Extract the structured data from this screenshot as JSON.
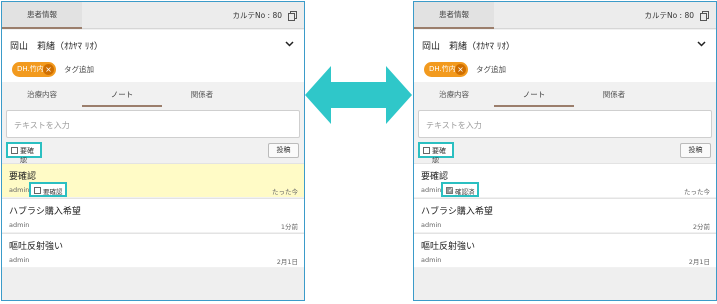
{
  "panels": [
    {
      "header": {
        "tab_label": "患者情報",
        "chart_no": "カルテNo : 80"
      },
      "patient": {
        "name": "岡山　莉緒（ｵｶﾔﾏ ﾘｵ）"
      },
      "tag": {
        "label": "DH.竹内",
        "add_label": "タグ追加"
      },
      "tabs": [
        {
          "label": "治療内容"
        },
        {
          "label": "ノート",
          "active": true
        },
        {
          "label": "関係者"
        }
      ],
      "input": {
        "placeholder": "テキストを入力"
      },
      "toolbar": {
        "filter_label": "要確認",
        "post_label": "投稿"
      },
      "notes": [
        {
          "title": "要確認",
          "author": "admin",
          "time": "たった今",
          "check_label": "要確認",
          "checked": false,
          "highlight": true
        },
        {
          "title": "ハブラシ購入希望",
          "author": "admin",
          "time": "1分前"
        },
        {
          "title": "嘔吐反射強い",
          "author": "admin",
          "time": "2月1日"
        }
      ]
    },
    {
      "header": {
        "tab_label": "患者情報",
        "chart_no": "カルテNo : 80"
      },
      "patient": {
        "name": "岡山　莉緒（ｵｶﾔﾏ ﾘｵ）"
      },
      "tag": {
        "label": "DH.竹内",
        "add_label": "タグ追加"
      },
      "tabs": [
        {
          "label": "治療内容"
        },
        {
          "label": "ノート",
          "active": true
        },
        {
          "label": "関係者"
        }
      ],
      "input": {
        "placeholder": "テキストを入力"
      },
      "toolbar": {
        "filter_label": "要確認",
        "post_label": "投稿"
      },
      "notes": [
        {
          "title": "要確認",
          "author": "admin",
          "time": "たった今",
          "check_label": "確認済",
          "checked": true,
          "highlight": false
        },
        {
          "title": "ハブラシ購入希望",
          "author": "admin",
          "time": "2分前"
        },
        {
          "title": "嘔吐反射強い",
          "author": "admin",
          "time": "2月1日"
        }
      ]
    }
  ],
  "colors": {
    "accent_teal": "#2bbfc1",
    "tag_orange": "#f29a1e",
    "highlight_yellow": "#fffbc6",
    "tab_underline": "#9b7e6c"
  },
  "icons": {
    "copy": "copy-icon",
    "expand": "chevron-down-icon",
    "remove_tag": "close-icon",
    "transition": "double-arrow-icon"
  }
}
